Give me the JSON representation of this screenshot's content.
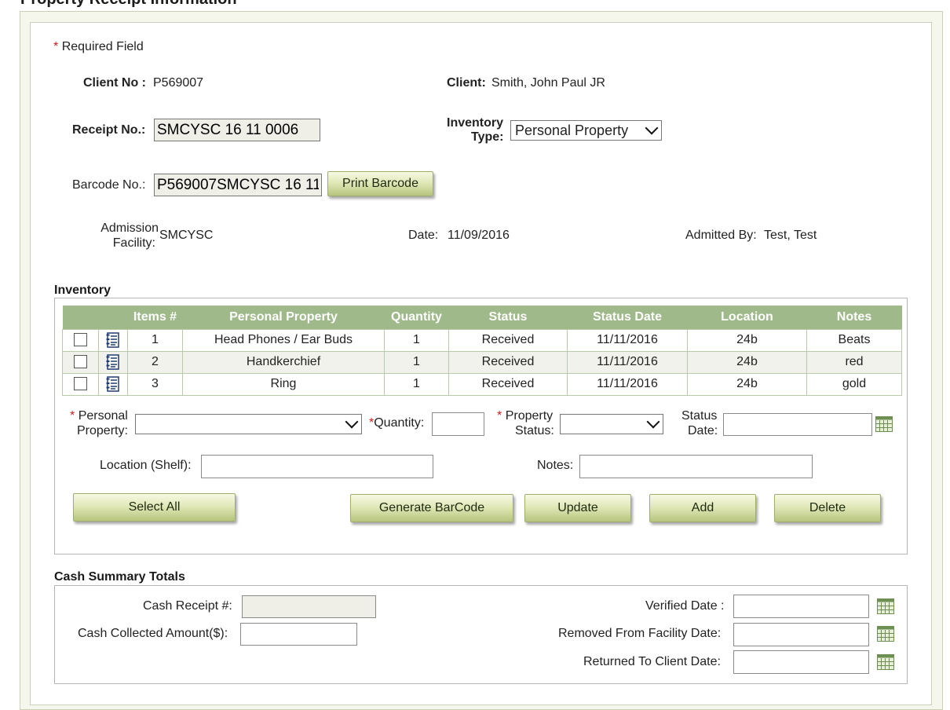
{
  "page": {
    "title": "Property Receipt Information"
  },
  "required_note": "Required Field",
  "required_marker": "*",
  "client": {
    "client_no_label": "Client No :",
    "client_no": "P569007",
    "client_label": "Client:",
    "client_name": "Smith, John Paul JR",
    "receipt_label": "Receipt No.:",
    "receipt_value": "SMCYSC 16 11 0006",
    "inventory_type_label_1": "Inventory",
    "inventory_type_label_2": "Type:",
    "inventory_type_value": "Personal Property",
    "barcode_label": "Barcode No.:",
    "barcode_value": "P569007SMCYSC 16 11",
    "print_barcode_label": "Print Barcode",
    "admission_label_1": "Admission",
    "admission_label_2": "Facility:",
    "admission_value": "SMCYSC",
    "date_label": "Date:",
    "date_value": "11/09/2016",
    "admitted_by_label": "Admitted By:",
    "admitted_by_value": "Test, Test"
  },
  "inventory": {
    "title": "Inventory",
    "columns": [
      "Items #",
      "Personal Property",
      "Quantity",
      "Status",
      "Status Date",
      "Location",
      "Notes"
    ],
    "rows": [
      {
        "item": "1",
        "property": "Head Phones / Ear Buds",
        "quantity": "1",
        "status": "Received",
        "status_date": "11/11/2016",
        "location": "24b",
        "notes": "Beats"
      },
      {
        "item": "2",
        "property": "Handkerchief",
        "quantity": "1",
        "status": "Received",
        "status_date": "11/11/2016",
        "location": "24b",
        "notes": "red"
      },
      {
        "item": "3",
        "property": "Ring",
        "quantity": "1",
        "status": "Received",
        "status_date": "11/11/2016",
        "location": "24b",
        "notes": "gold"
      }
    ],
    "form": {
      "personal_property_label_1": "Personal",
      "personal_property_label_2": "Property:",
      "quantity_label": "Quantity:",
      "property_status_label_1": "Property",
      "property_status_label_2": "Status:",
      "status_date_label_1": "Status",
      "status_date_label_2": "Date:",
      "location_label": "Location (Shelf):",
      "notes_label": "Notes:"
    },
    "buttons": {
      "select_all": "Select All",
      "generate_barcode": "Generate BarCode",
      "update": "Update",
      "add": "Add",
      "delete": "Delete"
    }
  },
  "cash_summary": {
    "title": "Cash Summary Totals",
    "cash_receipt_label": "Cash Receipt #:",
    "cash_collected_label": "Cash Collected Amount($):",
    "verified_date_label": "Verified Date :",
    "removed_date_label": "Removed From Facility Date:",
    "returned_date_label": "Returned To Client Date:"
  },
  "colors": {
    "table_header": "#9fb98a",
    "button_gradient_top": "#f7f9e3",
    "button_gradient_bottom": "#b6c57e",
    "required": "#d21a1a",
    "panel_border": "#c9d2b6"
  },
  "icons": [
    "document-list-icon",
    "calendar-icon",
    "chevron-down-icon"
  ]
}
